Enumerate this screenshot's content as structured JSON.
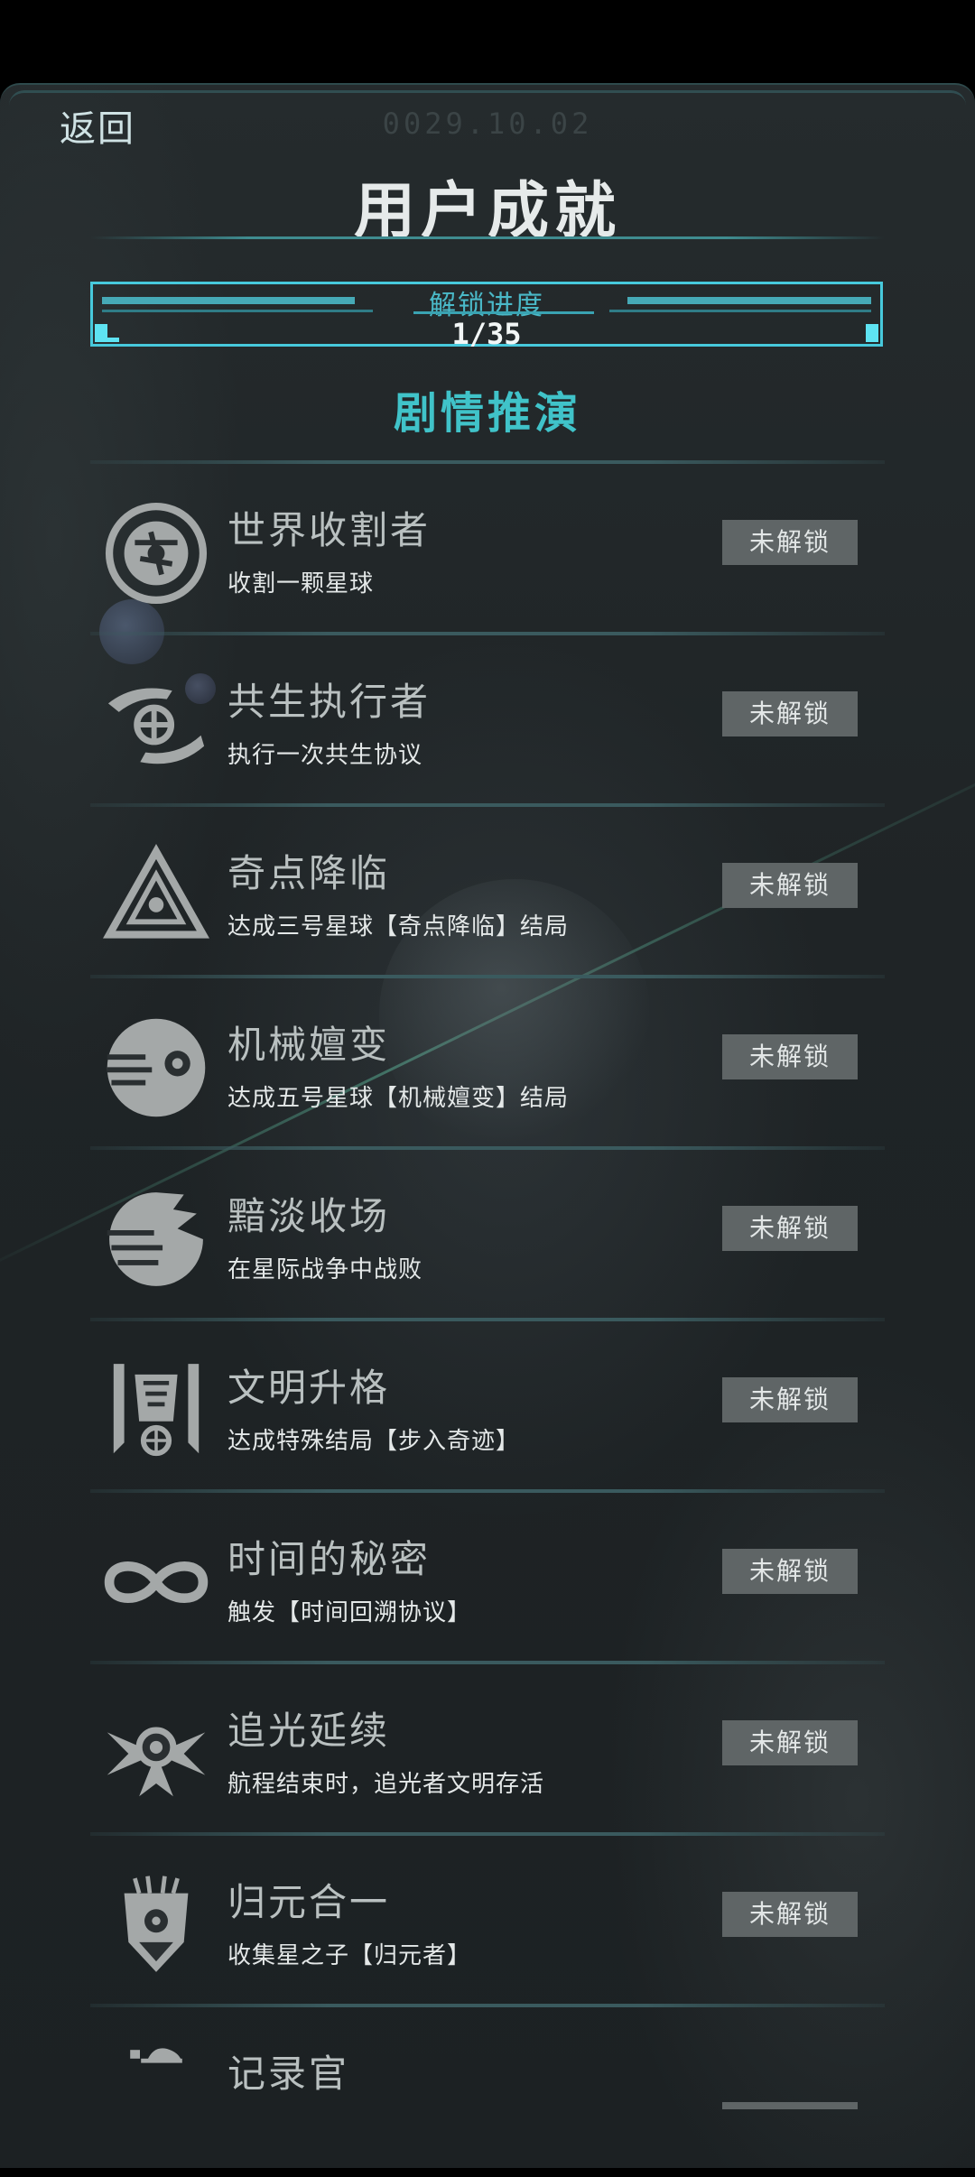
{
  "header": {
    "back_label": "返回",
    "date": "0029.10.02",
    "title": "用户成就"
  },
  "progress": {
    "label": "解锁进度",
    "value_text": "1/35",
    "fraction": 0.0286
  },
  "section_title": "剧情推演",
  "achievements": [
    {
      "name": "世界收割者",
      "desc": "收割一颗星球",
      "status": "未解锁",
      "icon": "planet-harvest-icon"
    },
    {
      "name": "共生执行者",
      "desc": "执行一次共生协议",
      "status": "未解锁",
      "icon": "symbiosis-hands-icon"
    },
    {
      "name": "奇点降临",
      "desc": "达成三号星球【奇点降临】结局",
      "status": "未解锁",
      "icon": "singularity-triangle-icon"
    },
    {
      "name": "机械嬗变",
      "desc": "达成五号星球【机械嬗变】结局",
      "status": "未解锁",
      "icon": "mechanical-eye-icon"
    },
    {
      "name": "黯淡收场",
      "desc": "在星际战争中战败",
      "status": "未解锁",
      "icon": "shattered-planet-icon"
    },
    {
      "name": "文明升格",
      "desc": "达成特殊结局【步入奇迹】",
      "status": "未解锁",
      "icon": "ascension-pillars-icon"
    },
    {
      "name": "时间的秘密",
      "desc": "触发【时间回溯协议】",
      "status": "未解锁",
      "icon": "infinity-icon"
    },
    {
      "name": "追光延续",
      "desc": "航程结束时，追光者文明存活",
      "status": "未解锁",
      "icon": "winged-emblem-icon"
    },
    {
      "name": "归元合一",
      "desc": "收集星之子【归元者】",
      "status": "未解锁",
      "icon": "tribal-mask-icon"
    },
    {
      "name": "记录官",
      "desc": "",
      "status": "",
      "icon": "recorder-icon"
    }
  ]
}
